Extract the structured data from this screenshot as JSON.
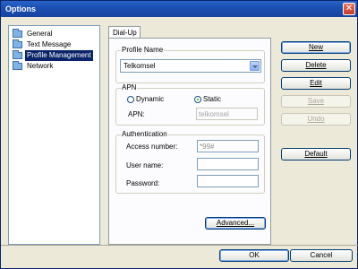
{
  "window": {
    "title": "Options",
    "close_symbol": "✕"
  },
  "tree": {
    "items": [
      {
        "label": "General",
        "selected": false
      },
      {
        "label": "Text Message",
        "selected": false
      },
      {
        "label": "Profile Management",
        "selected": true
      },
      {
        "label": "Network",
        "selected": false
      }
    ]
  },
  "tab": {
    "label": "Dial-Up"
  },
  "profile": {
    "legend": "Profile Name",
    "value": "Telkomsel"
  },
  "apn": {
    "legend": "APN",
    "dynamic_label": "Dynamic",
    "static_label": "Static",
    "selected": "Static",
    "apn_label": "APN:",
    "apn_value": "telkomsel"
  },
  "auth": {
    "legend": "Authentication",
    "access_label": "Access number:",
    "access_value": "*99#",
    "user_label": "User name:",
    "user_value": "",
    "password_label": "Password:",
    "password_value": ""
  },
  "buttons": {
    "advanced": "Advanced...",
    "new": "New",
    "delete": "Delete",
    "edit": "Edit",
    "save": "Save",
    "undo": "Undo",
    "default": "Default",
    "ok": "OK",
    "cancel": "Cancel"
  },
  "colors": {
    "titlebar": "#1b50b3",
    "selection": "#0a246a",
    "button_border": "#003c74"
  }
}
